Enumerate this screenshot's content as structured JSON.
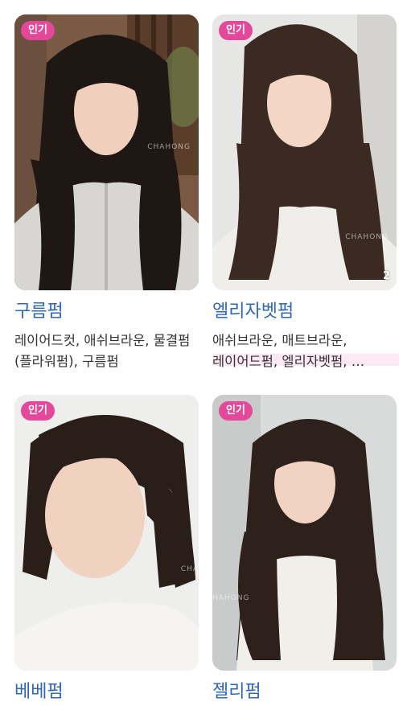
{
  "cards": [
    {
      "badge": "인기",
      "name": "구름펌",
      "tags": "레이어드컷, 애쉬브라운, 물결펌(플라워펌), 구름펌",
      "photo_count": "",
      "watermark": "CHAHONG"
    },
    {
      "badge": "인기",
      "name": "엘리자벳펌",
      "tags": "애쉬브라운, 매트브라운, 레이어드펌, 엘리자벳펌, …",
      "photo_count": "2",
      "watermark": "CHAHONG"
    },
    {
      "badge": "인기",
      "name": "베베펌",
      "tags": "",
      "photo_count": "",
      "watermark": "CHA"
    },
    {
      "badge": "인기",
      "name": "젤리펌",
      "tags": "",
      "photo_count": "",
      "watermark": "HAHONG"
    }
  ],
  "colors": {
    "badge": "#e3489a",
    "title": "#2f68b4",
    "tags": "#333333"
  }
}
